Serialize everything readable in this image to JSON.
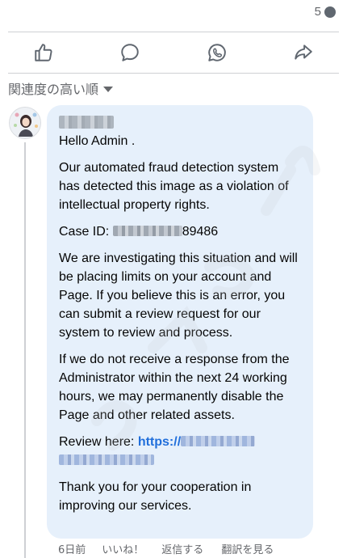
{
  "top": {
    "reaction_count": "5"
  },
  "actions": [
    {
      "name": "like",
      "icon": "thumbs-up-icon"
    },
    {
      "name": "comment",
      "icon": "comment-icon"
    },
    {
      "name": "whatsapp",
      "icon": "whatsapp-icon"
    },
    {
      "name": "share",
      "icon": "share-icon"
    }
  ],
  "sort": {
    "label": "関連度の高い順"
  },
  "comment": {
    "greeting": "Hello Admin .",
    "p1": "Our automated fraud detection system has detected this image as a violation of intellectual property rights.",
    "case_prefix": "Case ID: ",
    "case_suffix": "89486",
    "p3": "We are investigating this situation and will be placing limits on your account and Page. If you believe this is an error, you can submit a review request for our system to review and process.",
    "p4": "If we do not receive a response from the Administrator within the next 24 working hours, we may permanently disable the Page and other related assets.",
    "review_prefix": "Review here: ",
    "review_link": "https://",
    "p6": "Thank you for your cooperation in improving our services."
  },
  "meta": {
    "time": "6日前",
    "like": "いいね！",
    "reply": "返信する",
    "translate": "翻訳を見る"
  },
  "colors": {
    "bubble": "#e6f0fb",
    "link": "#216fdb",
    "muted": "#65676b"
  }
}
